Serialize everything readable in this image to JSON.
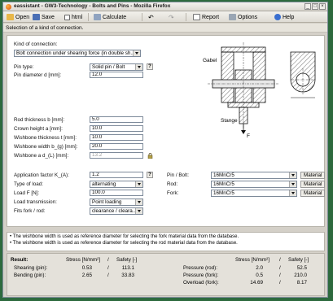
{
  "window": {
    "title": "eassistant - GW3-Technology - Bolts and Pins - Mozilla Firefox"
  },
  "toolbar": {
    "open": "Open",
    "save": "Save",
    "html": "html",
    "calculate": "Calculate",
    "report": "Report",
    "options": "Options",
    "help": "Help"
  },
  "subtitle": "Selection of a kind of connection.",
  "form": {
    "kind_label": "Kind of connection:",
    "kind_value": "Bolt connection under shearing force (in double sh...",
    "pin_type_label": "Pin type:",
    "pin_type_value": "Solid pin / Bolt",
    "pin_diam_label": "Pin diameter d [mm]:",
    "pin_diam_value": "12.0",
    "rod_thick_label": "Rod thickness b [mm]:",
    "rod_thick_value": "5.0",
    "crown_label": "Crown height a [mm]:",
    "crown_value": "10.0",
    "wish_thick_label": "Wishbone thickness t [mm]:",
    "wish_thick_value": "10.0",
    "wish_width_label": "Wishbone width b_(g) [mm]:",
    "wish_width_value": "20.0",
    "wish_ad_label": "Wishbone a d_(L) [mm]:",
    "wish_ad_value": "13.2",
    "app_factor_label": "Application factor K_(A):",
    "app_factor_value": "1.2",
    "type_load_label": "Type of load:",
    "type_load_value": "alternating",
    "load_label": "Load F [N]:",
    "load_value": "100.0",
    "transmission_label": "Load transmission:",
    "transmission_value": "Point loading",
    "fits_label": "Fits fork / rod:",
    "fits_value": "clearance / cleara..."
  },
  "materials": {
    "pin_label": "Pin / Bolt:",
    "pin_value": "16MnCr5",
    "rod_label": "Rod:",
    "rod_value": "16MnCr5",
    "fork_label": "Fork:",
    "fork_value": "16MnCr5",
    "button_label": "Material",
    "q_mark": "?"
  },
  "drawing_labels": {
    "gabel": "Gabel",
    "stange": "Stange",
    "f": "F"
  },
  "notes": [
    "The wishbone width is used as reference diameter for selecting the fork material data from the database.",
    "The wishbone width is used as reference diameter for selecting the rod material data from the database."
  ],
  "results": {
    "title": "Result:",
    "stress_header": "Stress [N/mm²]",
    "slash": "/",
    "safety_header": "Safety [-]",
    "left_rows": [
      {
        "label": "Shearing (pin):",
        "stress": "0.53",
        "safety": "113.1"
      },
      {
        "label": "Bending (pin):",
        "stress": "2.65",
        "safety": "33.83"
      }
    ],
    "right_rows": [
      {
        "label": "Pressure (rod):",
        "stress": "2.0",
        "safety": "52.5"
      },
      {
        "label": "Pressure (fork):",
        "stress": "0.5",
        "safety": "210.0"
      },
      {
        "label": "Overload (fork):",
        "stress": "14.69",
        "safety": "8.17"
      }
    ]
  },
  "colors": {
    "background": "#2d6a3e",
    "window": "#d4d0c8",
    "panel": "#ffffff"
  }
}
